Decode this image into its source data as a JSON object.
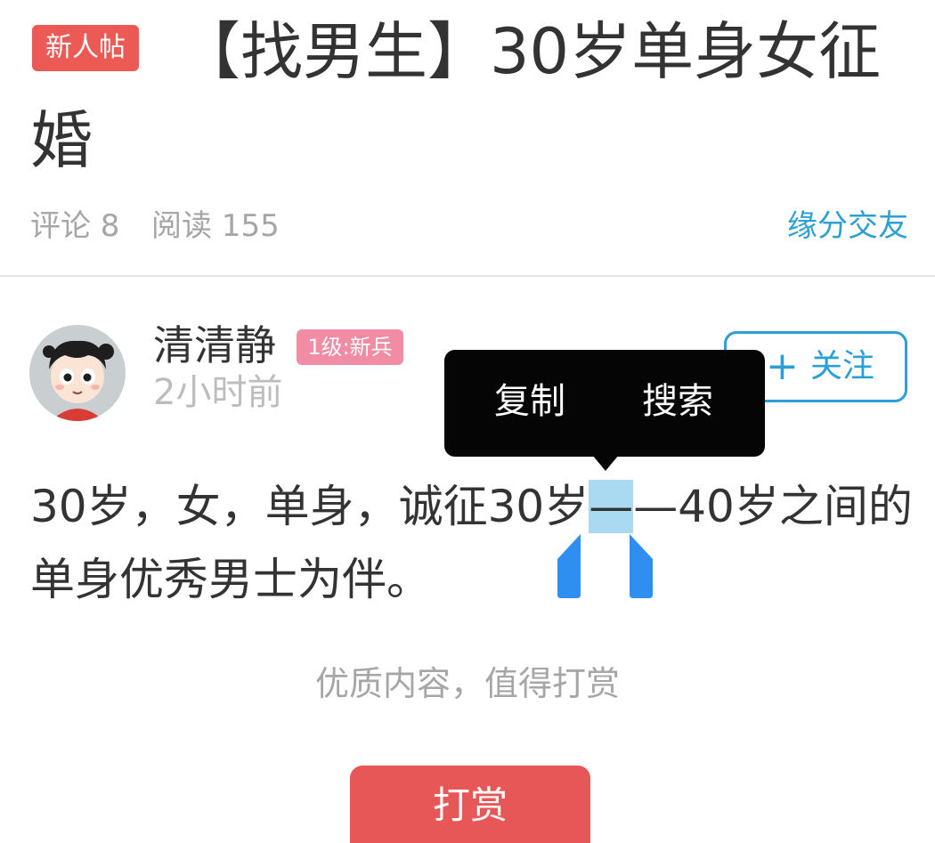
{
  "post": {
    "badge": "新人帖",
    "title_line1": "【找男生】30岁单身女征",
    "title_line2": "婚",
    "comments": "评论 8",
    "reads": "阅读 155",
    "category": "缘分交友"
  },
  "author": {
    "name": "清清静",
    "level": "1级:新兵",
    "time": "2小时前",
    "follow_icon": "+",
    "follow_label": "关注"
  },
  "body": {
    "line1_before": "30岁，女，单身，诚征30岁",
    "line1_selected": "—",
    "line1_after": "—40岁之间的",
    "line2": "单身优秀男士为伴。"
  },
  "context_menu": {
    "copy": "复制",
    "search": "搜索"
  },
  "reward": {
    "prompt": "优质内容，值得打赏",
    "button": "打赏"
  },
  "colors": {
    "badge_red": "#ec5a55",
    "link_blue": "#2b9fd6",
    "level_pink": "#f28ba4",
    "selection": "#a9daf2",
    "handle_blue": "#2f8ff0",
    "reward_red": "#e85757"
  },
  "icons": {
    "avatar": "cartoon-girl-avatar",
    "follow": "plus-icon",
    "selection_handles": "text-selection-handle"
  }
}
